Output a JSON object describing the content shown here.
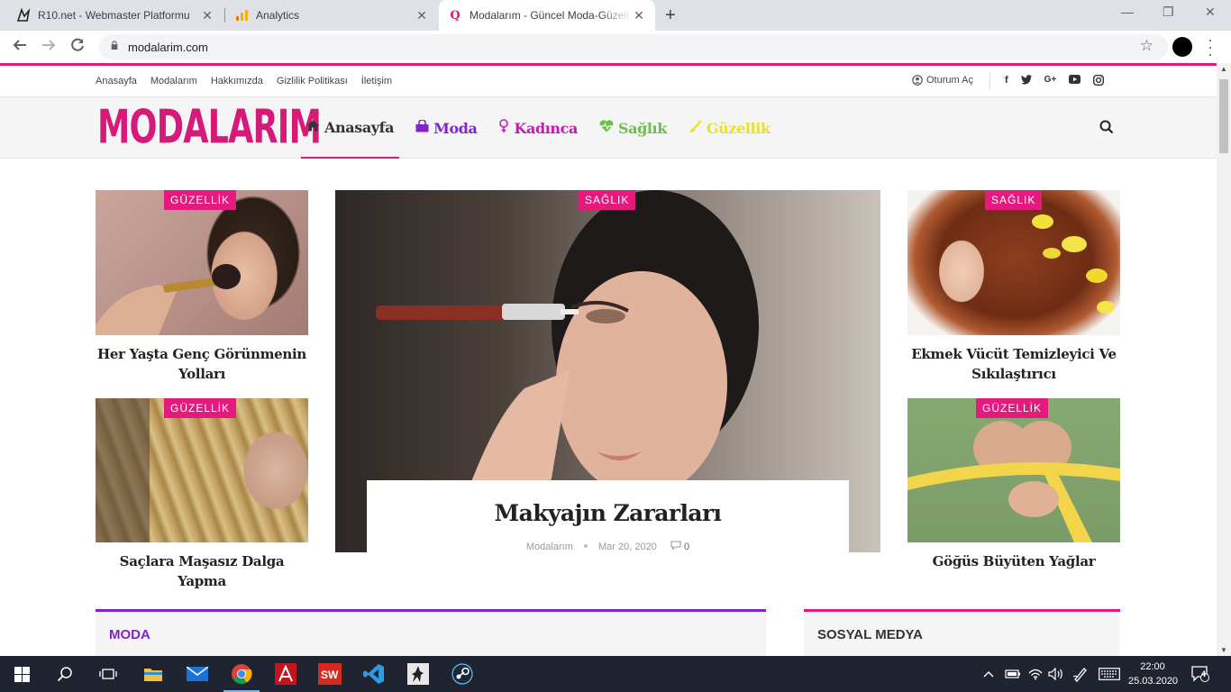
{
  "browser": {
    "tabs": [
      {
        "title": "R10.net - Webmaster Platformu",
        "icon": "r10-icon"
      },
      {
        "title": "Analytics",
        "icon": "analytics-icon"
      },
      {
        "title": "Modalarım - Güncel Moda-Güzellik",
        "icon": "modalarim-icon",
        "active": true
      }
    ],
    "url": "modalarim.com"
  },
  "site": {
    "logo": "MODALARIM",
    "top_links": [
      "Anasayfa",
      "Modalarım",
      "Hakkımızda",
      "Gizlilik Politikası",
      "İletişim"
    ],
    "login": "Oturum Aç",
    "menu": [
      {
        "label": "Anasayfa",
        "icon": "home-icon",
        "color": "#333333"
      },
      {
        "label": "Moda",
        "icon": "bag-icon",
        "color": "#8224c9"
      },
      {
        "label": "Kadınca",
        "icon": "female-icon",
        "color": "#c41ab4"
      },
      {
        "label": "Sağlık",
        "icon": "heartbeat-icon",
        "color": "#6cc04a"
      },
      {
        "label": "Güzellik",
        "icon": "brush-icon",
        "color": "#e8e02a"
      }
    ],
    "accent": "#e41a7f"
  },
  "featured": {
    "left": [
      {
        "badge": "GÜZELLİK",
        "title": "Her Yaşta Genç Görünmenin Yolları"
      },
      {
        "badge": "GÜZELLİK",
        "title": "Saçlara Maşasız Dalga Yapma"
      }
    ],
    "main": {
      "badge": "SAĞLIK",
      "title": "Makyajın Zararları",
      "author": "Modalarım",
      "date": "Mar 20, 2020",
      "comments": "0"
    },
    "right": [
      {
        "badge": "SAĞLIK",
        "title": "Ekmek Vücüt Temizleyici Ve Sıkılaştırıcı"
      },
      {
        "badge": "GÜZELLİK",
        "title": "Göğüs Büyüten Yağlar"
      }
    ]
  },
  "sections": {
    "moda": "MODA",
    "social": "SOSYAL MEDYA"
  },
  "taskbar": {
    "time": "22:00",
    "date": "25.03.2020",
    "notifications": "4"
  }
}
